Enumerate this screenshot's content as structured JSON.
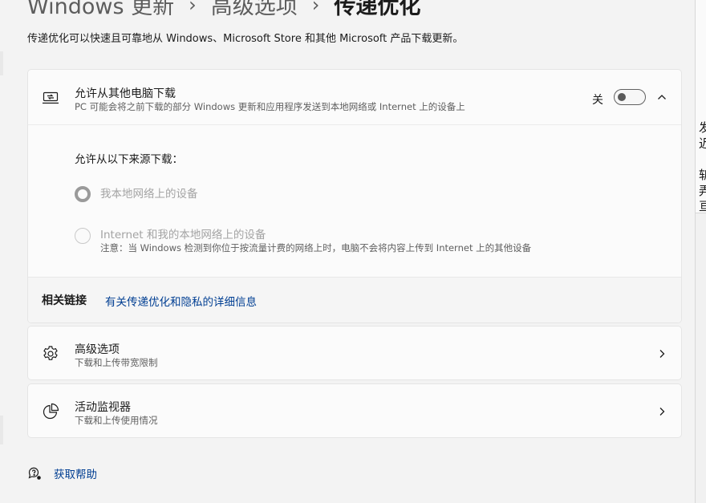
{
  "header": {
    "breadcrumb": [
      "Windows 更新",
      "高级选项",
      "传递优化"
    ],
    "separator": "›",
    "description": "传递优化可以快速且可靠地从 Windows、Microsoft Store 和其他 Microsoft 产品下载更新。"
  },
  "allow_download": {
    "icon": "pc-transfer-icon",
    "title": "允许从其他电脑下载",
    "subtitle": "PC 可能会将之前下载的部分 Windows 更新和应用程序发送到本地网络或 Internet 上的设备上",
    "toggle_state_label": "关",
    "toggle_on": false,
    "expanded": true,
    "sources_label": "允许从以下来源下载：",
    "options": [
      {
        "label": "我本地网络上的设备",
        "selected": true,
        "disabled": true
      },
      {
        "label": "Internet 和我的本地网络上的设备",
        "selected": false,
        "disabled": true,
        "note": "注意：当 Windows 检测到你位于按流量计费的网络上时，电脑不会将内容上传到 Internet 上的其他设备"
      }
    ]
  },
  "related": {
    "label": "相关链接",
    "link": "有关传递优化和隐私的详细信息"
  },
  "advanced": {
    "icon": "gear-icon",
    "title": "高级选项",
    "subtitle": "下载和上传带宽限制"
  },
  "monitor": {
    "icon": "pie-chart-icon",
    "title": "活动监视器",
    "subtitle": "下载和上传使用情况"
  },
  "help": {
    "icon": "help-chat-icon",
    "label": "获取帮助"
  },
  "side_fragments": [
    "发",
    "迟",
    "斩",
    "弄",
    "亘"
  ],
  "colors": {
    "background": "#f3f3f3",
    "card": "#fbfbfb",
    "link": "#003e92",
    "disabled_text": "#a3a3a3"
  }
}
